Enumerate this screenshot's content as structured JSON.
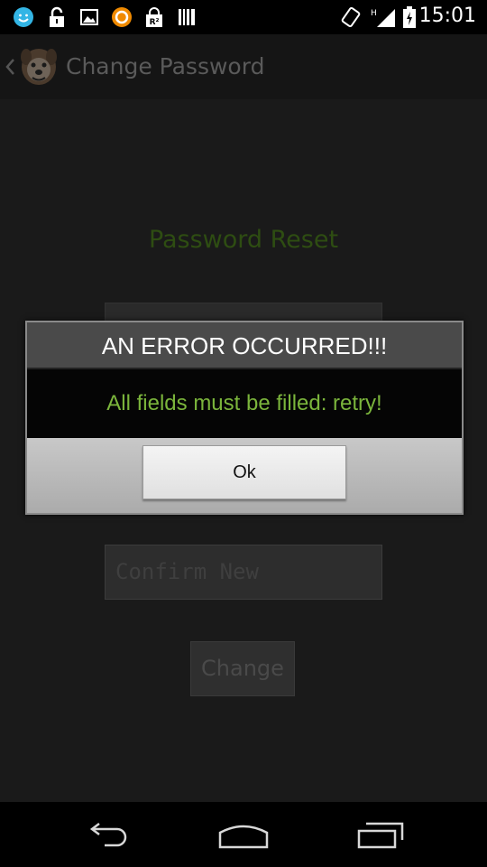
{
  "status_bar": {
    "time": "15:01",
    "icons": [
      "messenger-icon",
      "lock-icon",
      "image-icon",
      "orange-circle-icon",
      "r2-icon",
      "barcode-icon",
      "rotate-icon",
      "signal-icon",
      "battery-icon"
    ]
  },
  "action_bar": {
    "title": "Change Password",
    "back_icon": "chevron-left-icon",
    "logo_icon": "dog-logo-icon"
  },
  "form": {
    "heading": "Password Reset",
    "confirm_placeholder": "Confirm New",
    "change_label": "Change"
  },
  "dialog": {
    "title": "AN ERROR OCCURRED!!!",
    "message": "All fields must be filled: retry!",
    "ok_label": "Ok"
  },
  "nav_bar": {
    "icons": [
      "back-icon",
      "home-icon",
      "recent-apps-icon"
    ]
  },
  "colors": {
    "message_text": "#7bb53c",
    "heading_text": "#2e4d12",
    "dialog_title_bg": "#4a4a4a",
    "status_icon_blue": "#33b5e5"
  }
}
